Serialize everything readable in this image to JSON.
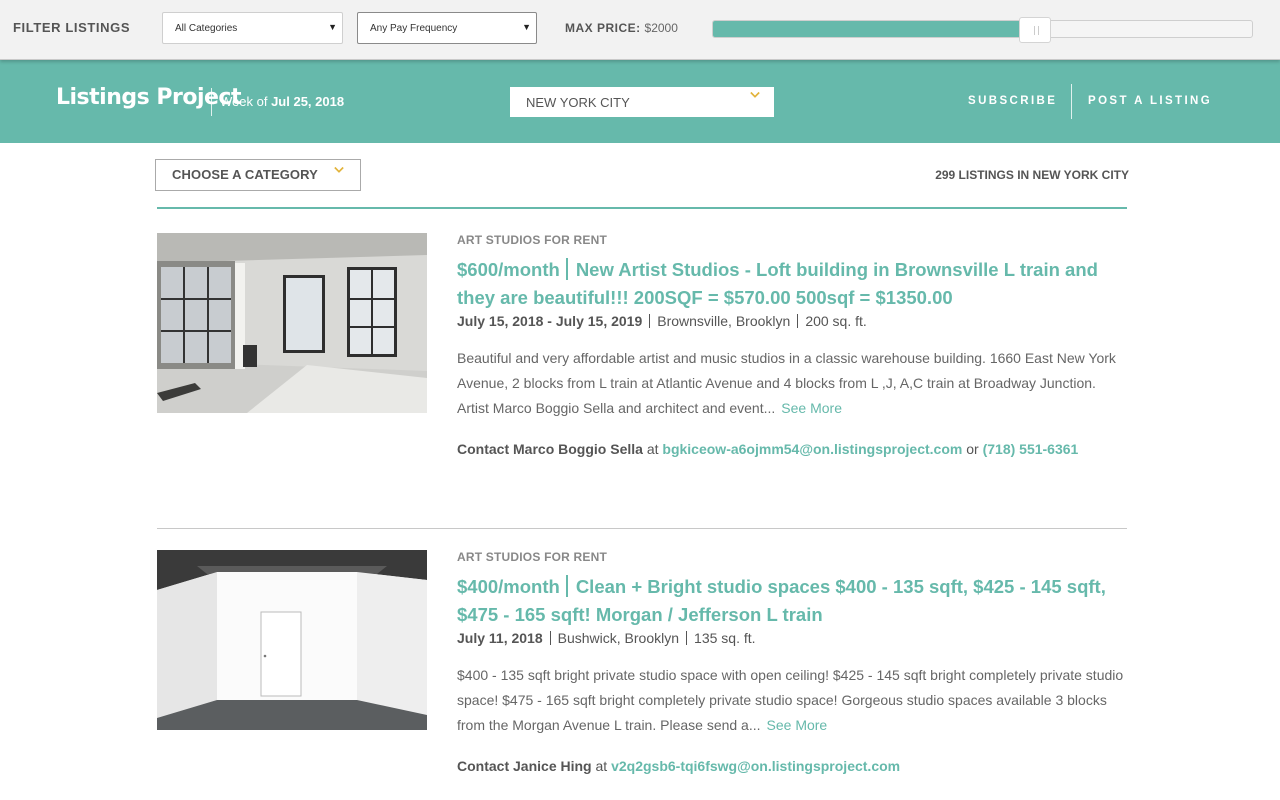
{
  "filter_bar": {
    "title": "FILTER LISTINGS",
    "category_select": "All Categories",
    "pay_select": "Any Pay Frequency",
    "max_price_label": "MAX PRICE:",
    "max_price_value": "$2000",
    "slider_fill_fraction": 0.6
  },
  "header": {
    "logo": "Listings Project",
    "week_prefix": "Week of",
    "week_date": "Jul 25, 2018",
    "city": "NEW YORK CITY",
    "nav": {
      "subscribe": "SUBSCRIBE",
      "post": "POST A LISTING"
    }
  },
  "toolbar": {
    "category_button": "CHOOSE A CATEGORY",
    "count": "299 LISTINGS IN NEW YORK CITY"
  },
  "listings": [
    {
      "category": "ART STUDIOS FOR RENT",
      "price": "$600/month",
      "title": "New Artist Studios - Loft building in Brownsville L train and they are beautiful!!! 200SQF = $570.00 500sqf = $1350.00",
      "dates": "July 15, 2018 - July 15, 2019",
      "location": "Brownsville, Brooklyn",
      "size": "200 sq. ft.",
      "description": "Beautiful and very affordable artist and music studios in a classic warehouse building. 1660 East New York Avenue, 2 blocks from L train at Atlantic Avenue and 4 blocks from L ,J, A,C train at Broadway Junction.  Artist Marco Boggio Sella and architect and event...",
      "see_more": "See More",
      "contact_prefix": "Contact",
      "contact_name": "Marco Boggio Sella",
      "contact_at": "at",
      "email": "bgkiceow-a6ojmm54@on.listingsproject.com",
      "or": "or",
      "phone": "(718) 551-6361"
    },
    {
      "category": "ART STUDIOS FOR RENT",
      "price": "$400/month",
      "title": "Clean + Bright studio spaces $400 - 135 sqft, $425 - 145 sqft, $475 - 165 sqft! Morgan / Jefferson L train",
      "dates": "July 11, 2018",
      "location": "Bushwick, Brooklyn",
      "size": "135 sq. ft.",
      "description": "$400 - 135 sqft bright private studio space with open ceiling! $425 - 145 sqft bright completely private studio space! $475 - 165 sqft bright completely private studio space!  Gorgeous studio spaces available 3 blocks from the Morgan Avenue L train.  Please send a...",
      "see_more": "See More",
      "contact_prefix": "Contact",
      "contact_name": "Janice Hing",
      "contact_at": "at",
      "email": "v2q2gsb6-tqi6fswg@on.listingsproject.com"
    }
  ],
  "colors": {
    "accent": "#66b9ab",
    "text": "#555555",
    "muted": "#888888"
  }
}
